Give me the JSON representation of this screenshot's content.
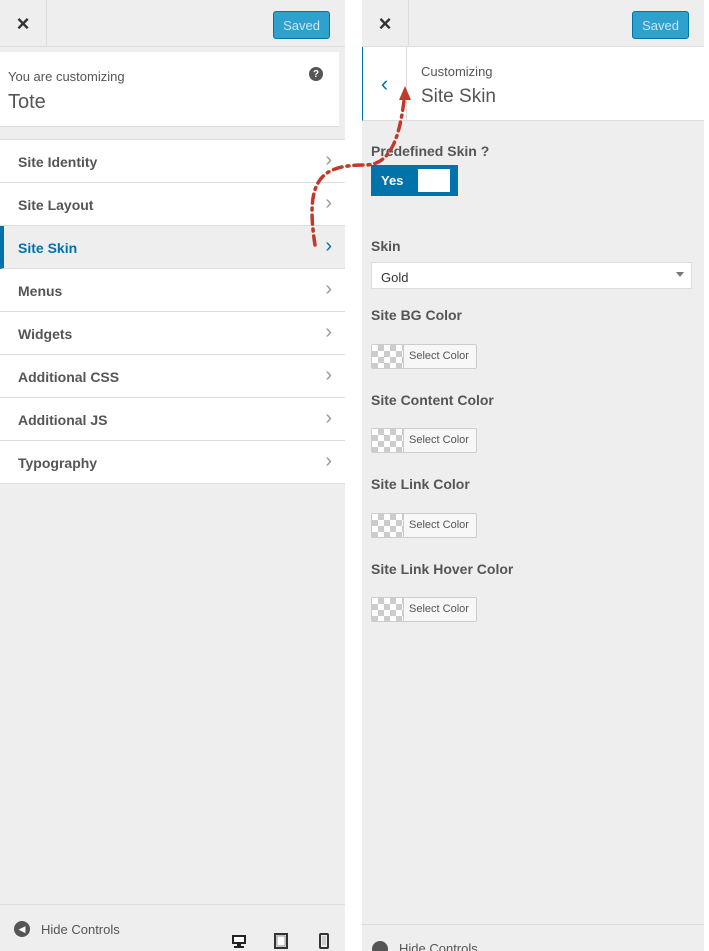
{
  "left": {
    "close_label": "×",
    "saved_label": "Saved",
    "info": {
      "label": "You are customizing",
      "title": "Tote",
      "help": "?"
    },
    "menu": [
      {
        "label": "Site Identity",
        "active": false
      },
      {
        "label": "Site Layout",
        "active": false
      },
      {
        "label": "Site Skin",
        "active": true
      },
      {
        "label": "Menus",
        "active": false
      },
      {
        "label": "Widgets",
        "active": false
      },
      {
        "label": "Additional CSS",
        "active": false
      },
      {
        "label": "Additional JS",
        "active": false
      },
      {
        "label": "Typography",
        "active": false
      }
    ],
    "chevron": "›",
    "footer": {
      "hide_label": "Hide Controls",
      "devices": [
        "desktop-icon",
        "tablet-icon",
        "mobile-icon"
      ]
    }
  },
  "right": {
    "close_label": "×",
    "saved_label": "Saved",
    "back": "‹",
    "crumb": "Customizing",
    "title": "Site Skin",
    "predefined_label": "Predefined Skin ?",
    "toggle_value": "Yes",
    "skin_label": "Skin",
    "skin_value": "Gold",
    "colors": [
      {
        "label": "Site BG Color",
        "button": "Select Color"
      },
      {
        "label": "Site Content Color",
        "button": "Select Color"
      },
      {
        "label": "Site Link Color",
        "button": "Select Color"
      },
      {
        "label": "Site Link Hover Color",
        "button": "Select Color"
      }
    ],
    "footer_label": "Hide Controls"
  },
  "theme": {
    "accent": "#0073aa",
    "saved_bg": "#2ea2cc",
    "panel_bg": "#eeeeee",
    "arrow_color": "#c0392b"
  }
}
